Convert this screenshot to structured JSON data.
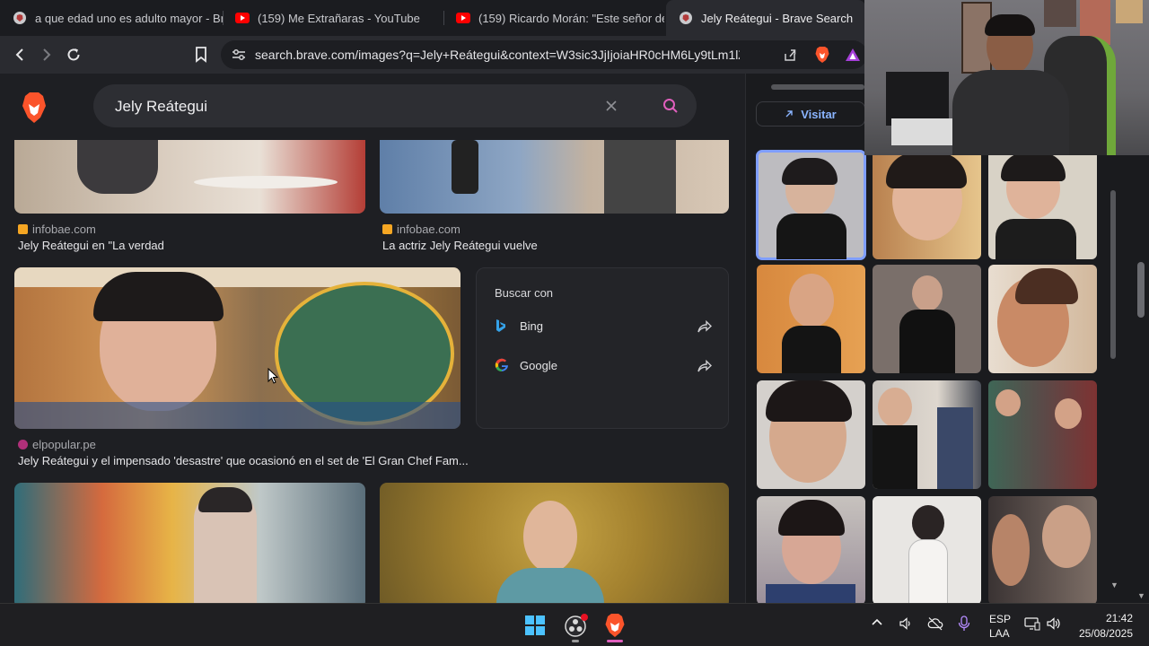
{
  "tabs": [
    {
      "title": "a que edad uno es adulto mayor - Br",
      "icon": "brave-icon"
    },
    {
      "title": "(159) Me Extrañaras - YouTube",
      "icon": "youtube-icon"
    },
    {
      "title": "(159) Ricardo Morán: \"Este señor deb",
      "icon": "youtube-icon"
    },
    {
      "title": "Jely Reátegui - Brave Search",
      "icon": "brave-icon"
    }
  ],
  "toolbar": {
    "url": "search.brave.com/images?q=Jely+Reátegui&context=W3sic3JjIjoiaHR0cHM6Ly9tLm1lZGlhL..."
  },
  "search": {
    "query": "Jely Reátegui"
  },
  "results": [
    {
      "source": "infobae.com",
      "caption": "Jely Reátegui en \"La verdad"
    },
    {
      "source": "infobae.com",
      "caption": "La actriz Jely Reátegui vuelve"
    },
    {
      "source": "elpopular.pe",
      "caption": "Jely Reátegui y el impensado 'desastre' que ocasionó en el set de 'El Gran Chef Fam..."
    }
  ],
  "search_with": {
    "title": "Buscar con",
    "engines": [
      {
        "name": "Bing",
        "icon": "bing-icon"
      },
      {
        "name": "Google",
        "icon": "google-icon"
      }
    ]
  },
  "panel": {
    "visit_label": "Visitar"
  },
  "taskbar": {
    "lang_top": "ESP",
    "lang_bottom": "LAA",
    "time": "21:42",
    "date": "25/08/2025"
  },
  "colors": {
    "accent": "#7f9eff",
    "brave_orange": "#fb542b",
    "youtube_red": "#ff0000",
    "search_icon": "#e05fbd"
  }
}
